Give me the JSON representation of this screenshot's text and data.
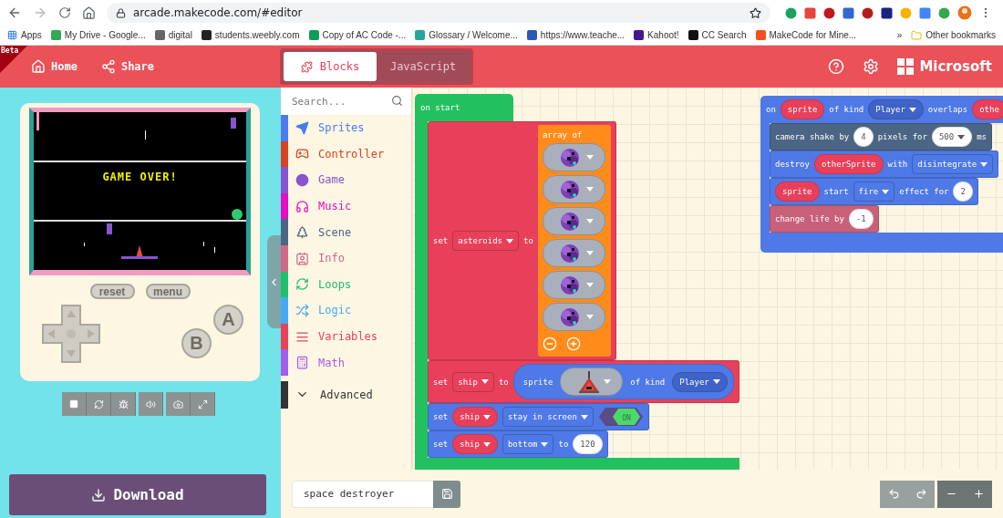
{
  "browser": {
    "url": "arcade.makecode.com/#editor",
    "bookmarks": [
      {
        "label": "Apps"
      },
      {
        "label": "My Drive - Google..."
      },
      {
        "label": "digital"
      },
      {
        "label": "students.weebly.com"
      },
      {
        "label": "Copy of AC Code -..."
      },
      {
        "label": "Glossary / Welcome..."
      },
      {
        "label": "https://www.teache..."
      },
      {
        "label": "Kahoot!"
      },
      {
        "label": "CC Search"
      },
      {
        "label": "MakeCode for Mine..."
      }
    ],
    "overflow": "»",
    "other_bookmarks": "Other bookmarks"
  },
  "header": {
    "badge": "Beta",
    "nav": [
      "Home",
      "Share"
    ],
    "tabs": [
      {
        "label": "Blocks",
        "selected": true
      },
      {
        "label": "JavaScript",
        "selected": false
      }
    ],
    "brand": "Microsoft"
  },
  "simulator": {
    "message": "GAME OVER!",
    "buttons": [
      "reset",
      "menu"
    ],
    "a": "A",
    "b": "B",
    "download": "Download"
  },
  "toolbox": {
    "placeholder": "Search...",
    "categories": [
      {
        "label": "Sprites",
        "color": "#4b7bec"
      },
      {
        "label": "Controller",
        "color": "#d54322"
      },
      {
        "label": "Game",
        "color": "#8854d0"
      },
      {
        "label": "Music",
        "color": "#e30fc0"
      },
      {
        "label": "Scene",
        "color": "#4b6584"
      },
      {
        "label": "Info",
        "color": "#cf6a87"
      },
      {
        "label": "Loops",
        "color": "#20bf6b"
      },
      {
        "label": "Logic",
        "color": "#45aaf2"
      },
      {
        "label": "Variables",
        "color": "#e8425a"
      },
      {
        "label": "Math",
        "color": "#a55eea"
      }
    ],
    "advanced": "Advanced"
  },
  "workspace": {
    "stacks": [
      {
        "color": "#23c05f",
        "hat": [
          {
            "kind": "text",
            "text": "on start"
          }
        ],
        "body": [
          {
            "color": "#e8405a",
            "parts": [
              {
                "kind": "text",
                "text": "set"
              },
              {
                "kind": "dropdown",
                "text": "asteroids"
              },
              {
                "kind": "text",
                "text": "to"
              },
              {
                "kind": "array",
                "label": "array of",
                "color": "#ff8c1a",
                "items": [
                  {
                    "kind": "picture"
                  },
                  {
                    "kind": "picture"
                  },
                  {
                    "kind": "picture"
                  },
                  {
                    "kind": "picture"
                  },
                  {
                    "kind": "picture"
                  },
                  {
                    "kind": "picture"
                  }
                ]
              }
            ]
          },
          {
            "color": "#e8405a",
            "parts": [
              {
                "kind": "text",
                "text": "set"
              },
              {
                "kind": "dropdown",
                "text": "ship"
              },
              {
                "kind": "text",
                "text": "to"
              },
              {
                "kind": "reporter",
                "color": "#4e79e6",
                "parts": [
                  {
                    "kind": "text",
                    "text": "sprite"
                  },
                  {
                    "kind": "picture"
                  },
                  {
                    "kind": "text",
                    "text": "of kind"
                  },
                  {
                    "kind": "enum",
                    "text": "Player"
                  }
                ]
              }
            ]
          },
          {
            "color": "#4e79e6",
            "parts": [
              {
                "kind": "text",
                "text": "set"
              },
              {
                "kind": "variable",
                "text": "ship"
              },
              {
                "kind": "dropdown",
                "text": "stay in screen"
              },
              {
                "kind": "toggle",
                "text": "ON",
                "on": true
              }
            ]
          },
          {
            "color": "#4e79e6",
            "parts": [
              {
                "kind": "text",
                "text": "set"
              },
              {
                "kind": "variable",
                "text": "ship"
              },
              {
                "kind": "dropdown",
                "text": "bottom"
              },
              {
                "kind": "text",
                "text": "to"
              },
              {
                "kind": "number",
                "text": "120"
              }
            ]
          }
        ]
      },
      {
        "color": "#4e79e6",
        "hat": [
          {
            "kind": "text",
            "text": "on"
          },
          {
            "kind": "parameter",
            "text": "sprite"
          },
          {
            "kind": "text",
            "text": "of kind"
          },
          {
            "kind": "enum",
            "text": "Player"
          },
          {
            "kind": "text",
            "text": "overlaps"
          },
          {
            "kind": "parameter",
            "text": "othe"
          }
        ],
        "body": [
          {
            "color": "#4b6584",
            "parts": [
              {
                "kind": "text",
                "text": "camera shake by"
              },
              {
                "kind": "number",
                "text": "4"
              },
              {
                "kind": "text",
                "text": "pixels for"
              },
              {
                "kind": "number_menu",
                "text": "500"
              },
              {
                "kind": "text",
                "text": "ms"
              }
            ]
          },
          {
            "color": "#4e79e6",
            "parts": [
              {
                "kind": "text",
                "text": "destroy"
              },
              {
                "kind": "parameter",
                "text": "otherSprite"
              },
              {
                "kind": "text",
                "text": "with"
              },
              {
                "kind": "dropdown",
                "text": "disintegrate"
              }
            ]
          },
          {
            "color": "#4e79e6",
            "parts": [
              {
                "kind": "parameter",
                "text": "sprite"
              },
              {
                "kind": "text",
                "text": "start"
              },
              {
                "kind": "dropdown",
                "text": "fire"
              },
              {
                "kind": "text",
                "text": "effect for"
              },
              {
                "kind": "number",
                "text": "2"
              }
            ]
          },
          {
            "color": "#c8607a",
            "parts": [
              {
                "kind": "text",
                "text": "change life by"
              },
              {
                "kind": "number",
                "text": "-1"
              }
            ]
          }
        ]
      }
    ]
  },
  "project": {
    "name": "space destroyer"
  }
}
